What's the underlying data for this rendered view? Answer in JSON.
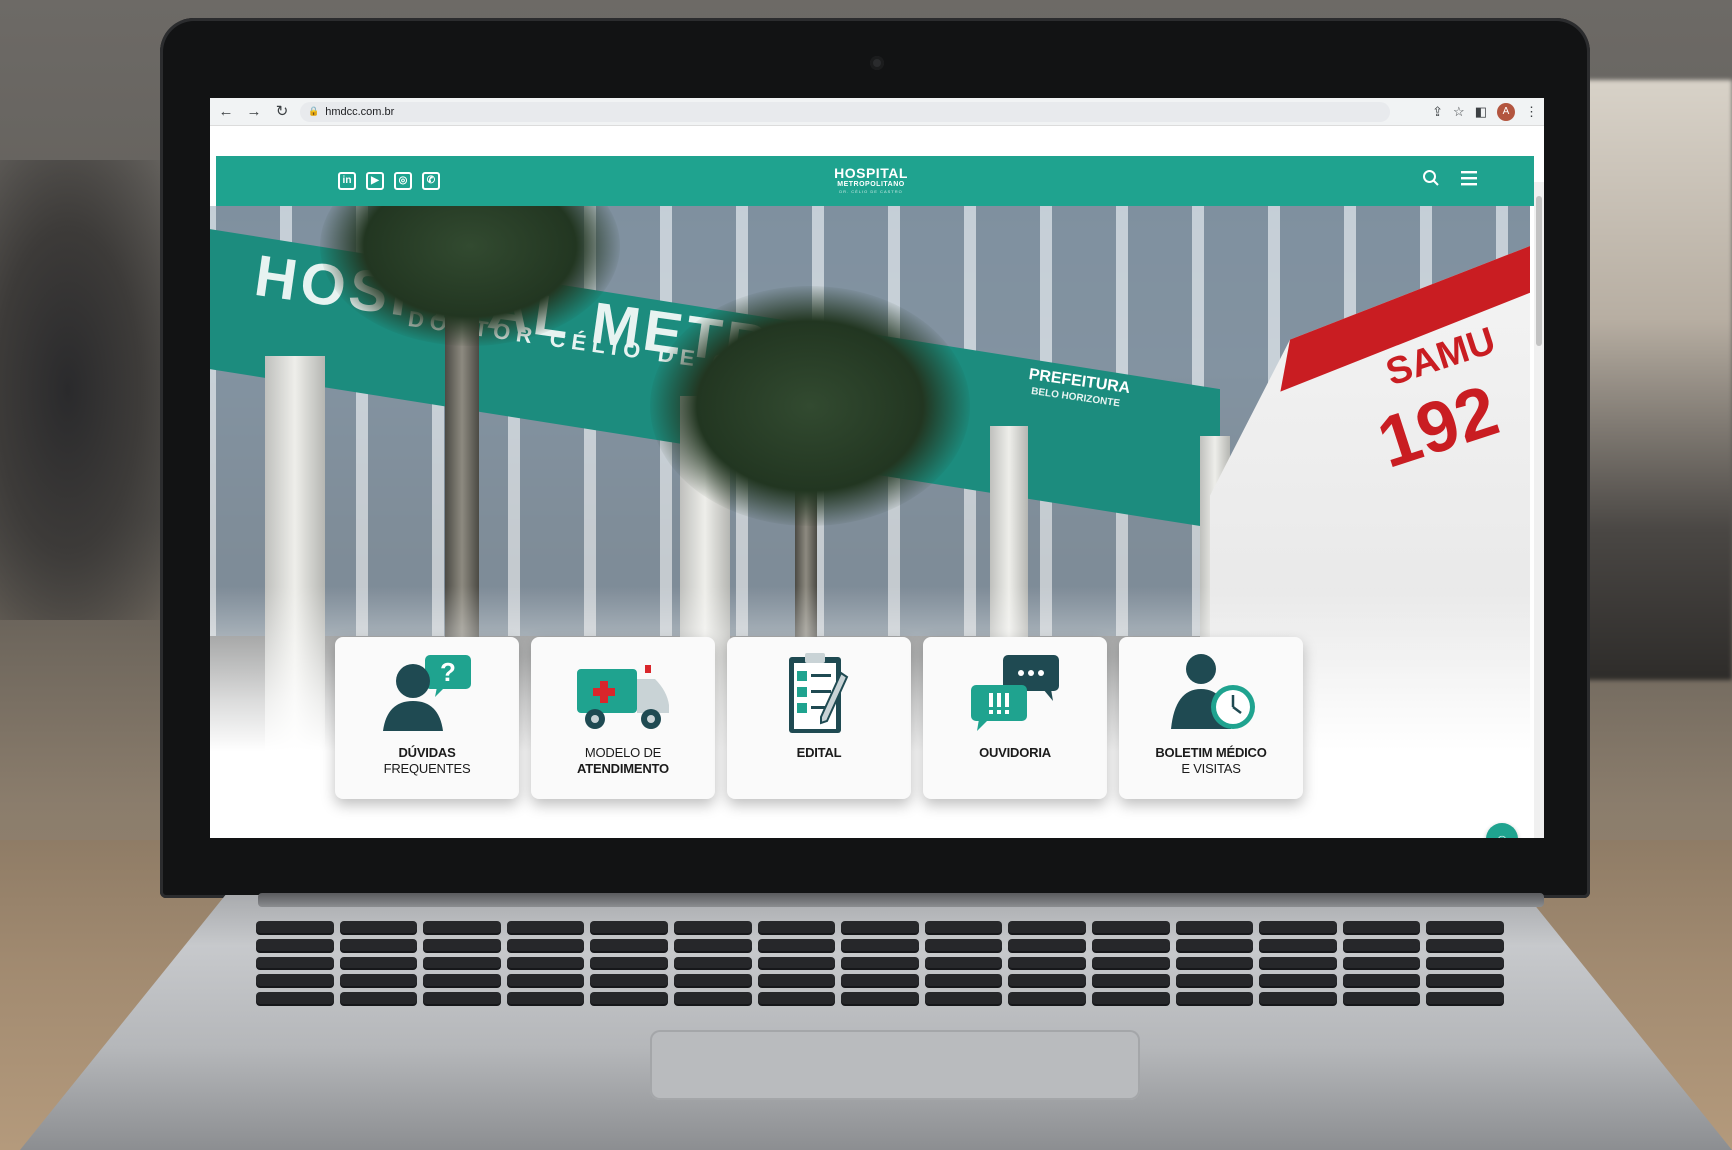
{
  "browser": {
    "url": "hmdcc.com.br",
    "avatar_letter": "A"
  },
  "header": {
    "logo_line1": "HOSPITAL",
    "logo_line2": "METROPOLITANO",
    "logo_line3": "DR. CÉLIO DE CASTRO",
    "social": [
      "in",
      "▶",
      "◎",
      "✆"
    ]
  },
  "hero": {
    "sign_main": "HOSPITAL METRO",
    "sign_sub": "DOUTOR CÉLIO DE CAST",
    "prefeitura": "PREFEITURA",
    "prefeitura_sub": "BELO HORIZONTE",
    "ambulance_samu": "SAMU",
    "ambulance_number": "192"
  },
  "cards": [
    {
      "line1": "DÚVIDAS",
      "line2": "FREQUENTES",
      "icon": "faq-person-icon"
    },
    {
      "line1": "MODELO DE",
      "line2": "ATENDIMENTO",
      "icon": "ambulance-icon"
    },
    {
      "line1": "EDITAL",
      "line2": "",
      "icon": "clipboard-checklist-icon"
    },
    {
      "line1": "OUVIDORIA",
      "line2": "",
      "icon": "chat-bubbles-icon"
    },
    {
      "line1": "BOLETIM MÉDICO",
      "line2": "E VISITAS",
      "icon": "person-clock-icon"
    }
  ],
  "colors": {
    "brand": "#1fa38f",
    "icon_dark": "#1f4a52",
    "accent_red": "#d9262b"
  }
}
